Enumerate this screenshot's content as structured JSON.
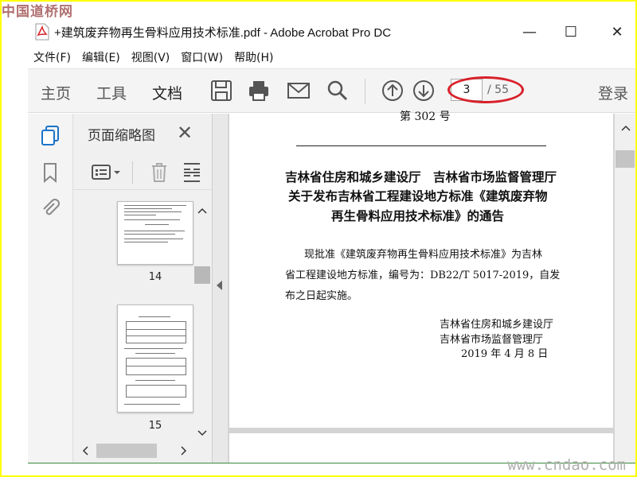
{
  "watermarks": {
    "top": "中国道桥网",
    "bottom": "www.cndao.com"
  },
  "window": {
    "title": "+建筑废弃物再生骨料应用技术标准.pdf - Adobe Acrobat Pro DC",
    "controls": {
      "minimize": "—",
      "maximize": "☐",
      "close": "✕"
    }
  },
  "menu": [
    "文件(F)",
    "编辑(E)",
    "视图(V)",
    "窗口(W)",
    "帮助(H)"
  ],
  "toolbar": {
    "tabs": [
      "主页",
      "工具",
      "文档"
    ],
    "active_tab": "文档",
    "page_current": "3",
    "page_total": "/ 55",
    "login": "登录",
    "icons": [
      "save-icon",
      "print-icon",
      "email-icon",
      "search-icon",
      "page-up-icon",
      "page-down-icon"
    ]
  },
  "panel": {
    "title": "页面缩略图",
    "close": "✕",
    "thumbnails": [
      {
        "label": "14"
      },
      {
        "label": "15"
      }
    ]
  },
  "document": {
    "header_fragment": "第 302 号",
    "title_lines": [
      "吉林省住房和城乡建设厅　吉林省市场监督管理厅",
      "关于发布吉林省工程建设地方标准《建筑废弃物",
      "再生骨料应用技术标准》的通告"
    ],
    "body_lines": [
      "现批准《建筑废弃物再生骨料应用技术标准》为吉林",
      "省工程建设地方标准，编号为：DB22/T 5017-2019，自发",
      "布之日起实施。"
    ],
    "signature": [
      "吉林省住房和城乡建设厅",
      "吉林省市场监督管理厅",
      "2019 年 4 月 8 日"
    ]
  },
  "colors": {
    "highlight_oval": "#d8202a",
    "accent_blue": "#1a73c9"
  }
}
